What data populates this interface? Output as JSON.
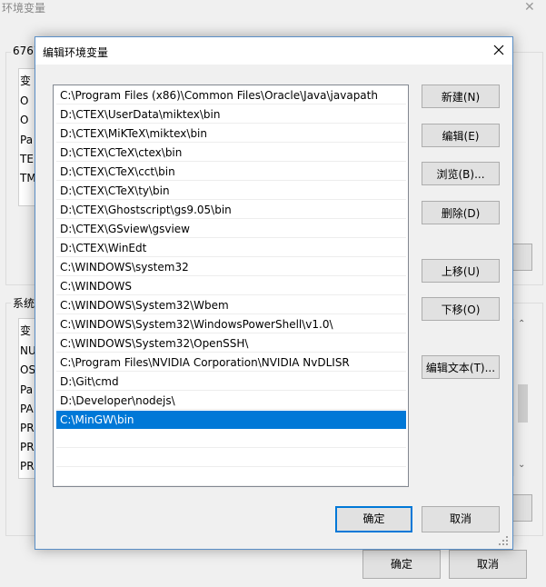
{
  "parent_window": {
    "title": "环境变量",
    "user_group_label": "6767",
    "user_list_header": "变",
    "user_rows": [
      "O",
      "O",
      "Pa",
      "TE",
      "TM"
    ],
    "system_group_label": "系统",
    "system_list_header": "变",
    "system_rows": [
      "NU",
      "OS",
      "Pa",
      "PA",
      "PR",
      "PR",
      "PR"
    ],
    "ok_label": "确定",
    "cancel_label": "取消"
  },
  "dialog": {
    "title": "编辑环境变量",
    "paths": [
      "C:\\Program Files (x86)\\Common Files\\Oracle\\Java\\javapath",
      "D:\\CTEX\\UserData\\miktex\\bin",
      "D:\\CTEX\\MiKTeX\\miktex\\bin",
      "D:\\CTEX\\CTeX\\ctex\\bin",
      "D:\\CTEX\\CTeX\\cct\\bin",
      "D:\\CTEX\\CTeX\\ty\\bin",
      "D:\\CTEX\\Ghostscript\\gs9.05\\bin",
      "D:\\CTEX\\GSview\\gsview",
      "D:\\CTEX\\WinEdt",
      "C:\\WINDOWS\\system32",
      "C:\\WINDOWS",
      "C:\\WINDOWS\\System32\\Wbem",
      "C:\\WINDOWS\\System32\\WindowsPowerShell\\v1.0\\",
      "C:\\WINDOWS\\System32\\OpenSSH\\",
      "C:\\Program Files\\NVIDIA Corporation\\NVIDIA NvDLISR",
      "D:\\Git\\cmd",
      "D:\\Developer\\nodejs\\",
      "C:\\MinGW\\bin"
    ],
    "selected_index": 17,
    "buttons": {
      "new": "新建(N)",
      "edit": "编辑(E)",
      "browse": "浏览(B)...",
      "delete": "删除(D)",
      "move_up": "上移(U)",
      "move_down": "下移(O)",
      "edit_text": "编辑文本(T)..."
    },
    "ok_label": "确定",
    "cancel_label": "取消"
  },
  "colors": {
    "selection": "#0078d7",
    "dialog_border": "#5a8fc7"
  }
}
